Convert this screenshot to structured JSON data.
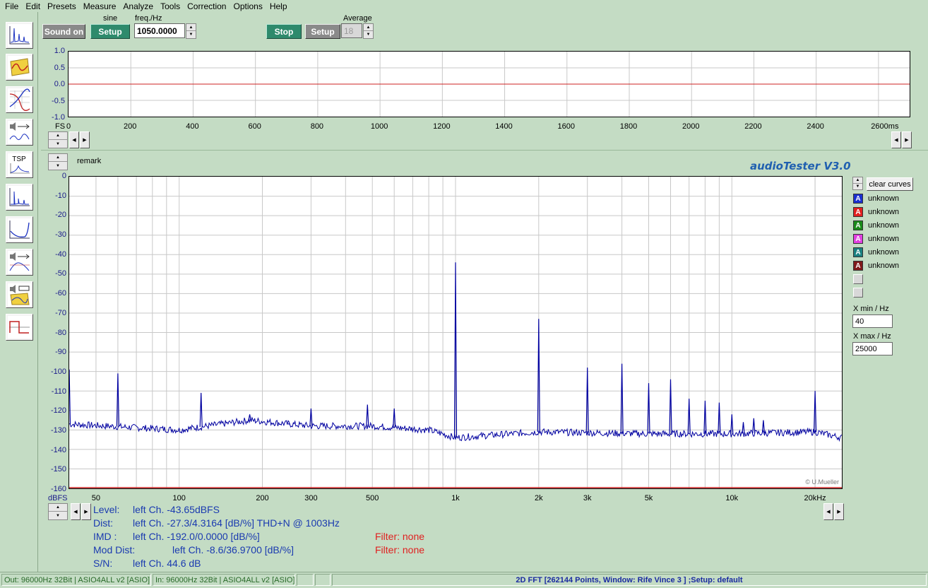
{
  "menu": [
    "File",
    "Edit",
    "Presets",
    "Measure",
    "Analyze",
    "Tools",
    "Correction",
    "Options",
    "Help"
  ],
  "toolbar_icons": [
    "fft-spectrum-icon",
    "oscilloscope-icon",
    "frequency-response-icon",
    "speaker-sweep-icon",
    "tsp-icon",
    "impulse-icon",
    "impedance-icon",
    "speaker-response-icon",
    "speaker-box-icon",
    "square-wave-icon"
  ],
  "tsp_label": "TSP",
  "generator": {
    "sound_on_label": "Sound on",
    "type_label": "sine",
    "setup_label": "Setup",
    "freq_label": "freq./Hz",
    "freq_value": "1050.0000"
  },
  "analyzer": {
    "stop_label": "Stop",
    "setup_label": "Setup",
    "average_label": "Average",
    "average_value": "18"
  },
  "time_plot": {
    "y_ticks": [
      "1.0",
      "0.5",
      "0.0",
      "-0.5",
      "-1.0"
    ],
    "x_prefix": "FS",
    "x_ticks": [
      "0",
      "200",
      "400",
      "600",
      "800",
      "1000",
      "1200",
      "1400",
      "1600",
      "1800",
      "2000",
      "2200",
      "2400",
      "2600ms"
    ],
    "trace_color": "#cc2020"
  },
  "remark_label": "remark",
  "brand": "audioTester  V3.0",
  "watermark": "© U.Mueller",
  "chart_data": {
    "type": "line",
    "x_scale": "log",
    "xlim": [
      40,
      25000
    ],
    "ylim": [
      -160,
      0
    ],
    "ylabel": "dBFS",
    "x_tick_labels": [
      "50",
      "100",
      "200",
      "300",
      "500",
      "1k",
      "2k",
      "3k",
      "5k",
      "10k",
      "20kHz"
    ],
    "x_tick_values": [
      50,
      100,
      200,
      300,
      500,
      1000,
      2000,
      3000,
      5000,
      10000,
      20000
    ],
    "y_tick_labels": [
      "0",
      "-10",
      "-20",
      "-30",
      "-40",
      "-50",
      "-60",
      "-70",
      "-80",
      "-90",
      "-100",
      "-110",
      "-120",
      "-130",
      "-140",
      "-150",
      "-160"
    ],
    "grid": true,
    "series": [
      {
        "color": "#0000a0",
        "noise_floor": [
          [
            40,
            -127
          ],
          [
            100,
            -130
          ],
          [
            180,
            -125
          ],
          [
            300,
            -128
          ],
          [
            500,
            -128
          ],
          [
            800,
            -130
          ],
          [
            1000,
            -134
          ],
          [
            2000,
            -131
          ],
          [
            5000,
            -132
          ],
          [
            10000,
            -132
          ],
          [
            20000,
            -131
          ],
          [
            25000,
            -134
          ]
        ],
        "peaks": [
          [
            40,
            -99
          ],
          [
            60,
            -101
          ],
          [
            120,
            -111
          ],
          [
            180,
            -122
          ],
          [
            250,
            -127
          ],
          [
            300,
            -119
          ],
          [
            480,
            -117
          ],
          [
            600,
            -119
          ],
          [
            1000,
            -44
          ],
          [
            2000,
            -73
          ],
          [
            3000,
            -98
          ],
          [
            4000,
            -96
          ],
          [
            5000,
            -106
          ],
          [
            6000,
            -104
          ],
          [
            7000,
            -114
          ],
          [
            8000,
            -115
          ],
          [
            9000,
            -116
          ],
          [
            10000,
            -122
          ],
          [
            11000,
            -126
          ],
          [
            12000,
            -124
          ],
          [
            13000,
            -125
          ],
          [
            20000,
            -110
          ]
        ]
      }
    ]
  },
  "legend": {
    "clear_label": "clear curves",
    "items": [
      {
        "color": "#1a30d0",
        "label": "unknown"
      },
      {
        "color": "#e02020",
        "label": "unknown"
      },
      {
        "color": "#1a8a1a",
        "label": "unknown"
      },
      {
        "color": "#e040e0",
        "label": "unknown"
      },
      {
        "color": "#1a8080",
        "label": "unknown"
      },
      {
        "color": "#801a1a",
        "label": "unknown"
      }
    ],
    "glyph": "A"
  },
  "range": {
    "xmin_label": "X min / Hz",
    "xmin_value": "40",
    "xmax_label": "X max / Hz",
    "xmax_value": "25000"
  },
  "results": {
    "level_label": "Level:",
    "level_value": "left Ch. -43.65dBFS",
    "dist_label": "Dist:",
    "dist_value": "left Ch. -27.3/4.3164 [dB/%] THD+N  @ 1003Hz",
    "imd_label": "IMD  :",
    "imd_value": "left Ch. -192.0/0.0000 [dB/%]",
    "moddist_label": "Mod Dist:",
    "moddist_value": "left Ch. -8.6/36.9700 [dB/%]",
    "sn_label": "S/N:",
    "sn_value": "left Ch. 44.6 dB",
    "filter1": "Filter: none",
    "filter2": "Filter: none"
  },
  "status": {
    "out": "Out: 96000Hz 32Bit  | ASIO4ALL v2 [ASIO]",
    "in": "In: 96000Hz 32Bit  | ASIO4ALL v2 [ASIO]",
    "main": "2D FFT [262144 Points, Window: Rife Vince 3 ] ;Setup:  default"
  }
}
